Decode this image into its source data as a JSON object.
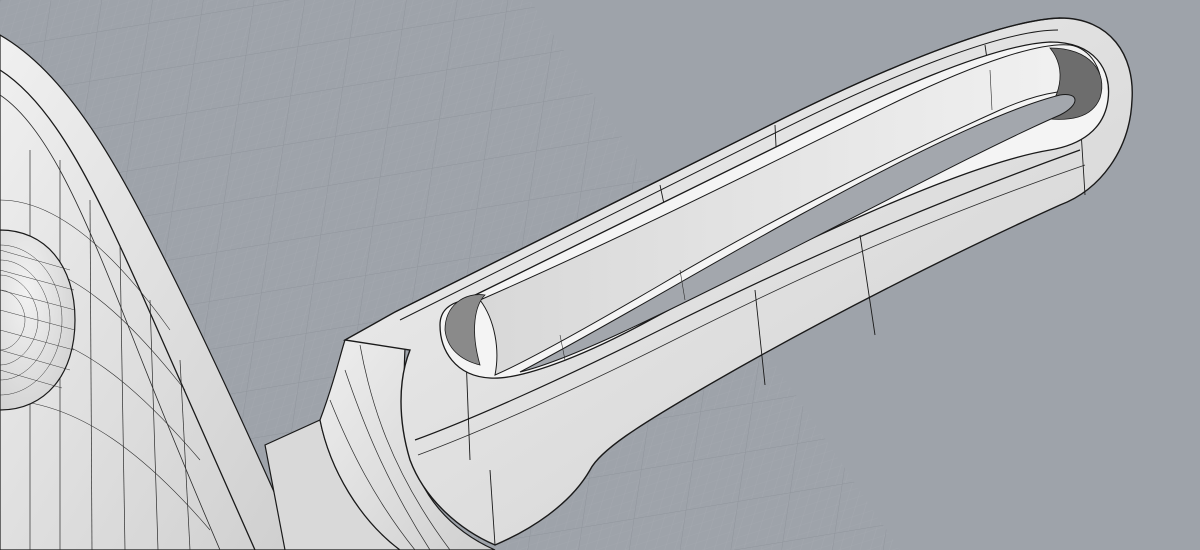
{
  "viewport": {
    "view_name": "",
    "background_color": "#9ea3aa",
    "grid_color": "#8f949b",
    "grid_minor_color": "#a9adb3",
    "surface_color": "#e6e6e6",
    "surface_shade_color": "#c9c9c9",
    "edge_color": "#1a1a1a",
    "isocurve_color": "#2b2b2b"
  },
  "scene": {
    "description_visible_text": ""
  }
}
